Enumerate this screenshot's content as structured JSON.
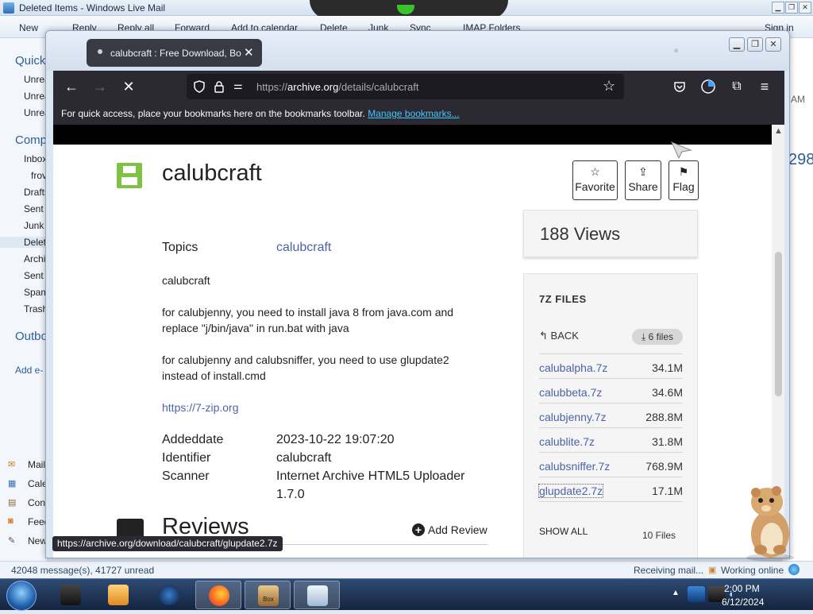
{
  "mail": {
    "title": "Deleted Items - Windows Live Mail",
    "ribbon": [
      "New",
      "Reply",
      "Reply all",
      "Forward",
      "Add to calendar",
      "Delete",
      "Junk",
      "Sync",
      "IMAP Folders",
      "Sign in"
    ],
    "left_pane": {
      "quick": "Quick",
      "quick_items": [
        "Unrea",
        "Unrea",
        "Unrea"
      ],
      "comp": "Comp",
      "comp_items": [
        "Inbox",
        "frov",
        "Drafts",
        "Sent",
        "Junk",
        "Delet",
        "Archi",
        "Sent",
        "Spam",
        "Trash"
      ],
      "outbox": "Outbo",
      "add": "Add e-",
      "bottom_items": [
        "Mail",
        "Cale",
        "Con",
        "Feed",
        "New"
      ]
    },
    "right_pane": {
      "am": "AM",
      "num": "298"
    },
    "status": {
      "messages": "42048 message(s), 41727 unread",
      "receiving": "Receiving mail...",
      "online": "Working online"
    }
  },
  "browser": {
    "tab_title": "calubcraft : Free Download, Bor",
    "url_prefix": "https://",
    "url_host": "archive.org",
    "url_path": "/details/calubcraft",
    "bookmarks_text": "For quick access, place your bookmarks here on the bookmarks toolbar.",
    "bookmarks_link": "Manage bookmarks...",
    "status_url": "https://archive.org/download/calubcraft/glupdate2.7z"
  },
  "page": {
    "title": "calubcraft",
    "actions": {
      "favorite": "Favorite",
      "share": "Share",
      "flag": "Flag"
    },
    "topics_label": "Topics",
    "topics_value": "calubcraft",
    "desc1": "calubcraft",
    "desc2a": "for calubjenny, you need to install java 8 from java.com and",
    "desc2b": "replace \"j/bin/java\" in run.bat with java",
    "desc3a": "for calubjenny and calubsniffer, you need to use glupdate2",
    "desc3b": "instead of install.cmd",
    "link": "https://7-zip.org",
    "meta": [
      {
        "label": "Addeddate",
        "value": "2023-10-22 19:07:20"
      },
      {
        "label": "Identifier",
        "value": "calubcraft"
      },
      {
        "label": "Scanner",
        "value": "Internet Archive HTML5 Uploader"
      }
    ],
    "scanner_version": "1.7.0",
    "views": "188 Views",
    "files_heading": "7Z FILES",
    "back_label": "BACK",
    "files_pill": "6 files",
    "files": [
      {
        "name": "calubalpha.7z",
        "size": "34.1M"
      },
      {
        "name": "calubbeta.7z",
        "size": "34.6M"
      },
      {
        "name": "calubjenny.7z",
        "size": "288.8M"
      },
      {
        "name": "calublite.7z",
        "size": "31.8M"
      },
      {
        "name": "calubsniffer.7z",
        "size": "768.9M"
      },
      {
        "name": "glupdate2.7z",
        "size": "17.1M"
      }
    ],
    "show_all": "SHOW ALL",
    "files_count": "10 Files",
    "reviews_title": "Reviews",
    "add_review": "Add Review"
  },
  "taskbar": {
    "time": "2:00 PM",
    "date": "6/12/2024",
    "hamster_box": "Box"
  },
  "colors": {
    "firefox_dark": "#2b2a33",
    "archive_link": "#4b64a8",
    "archive_green": "#7fc142"
  }
}
